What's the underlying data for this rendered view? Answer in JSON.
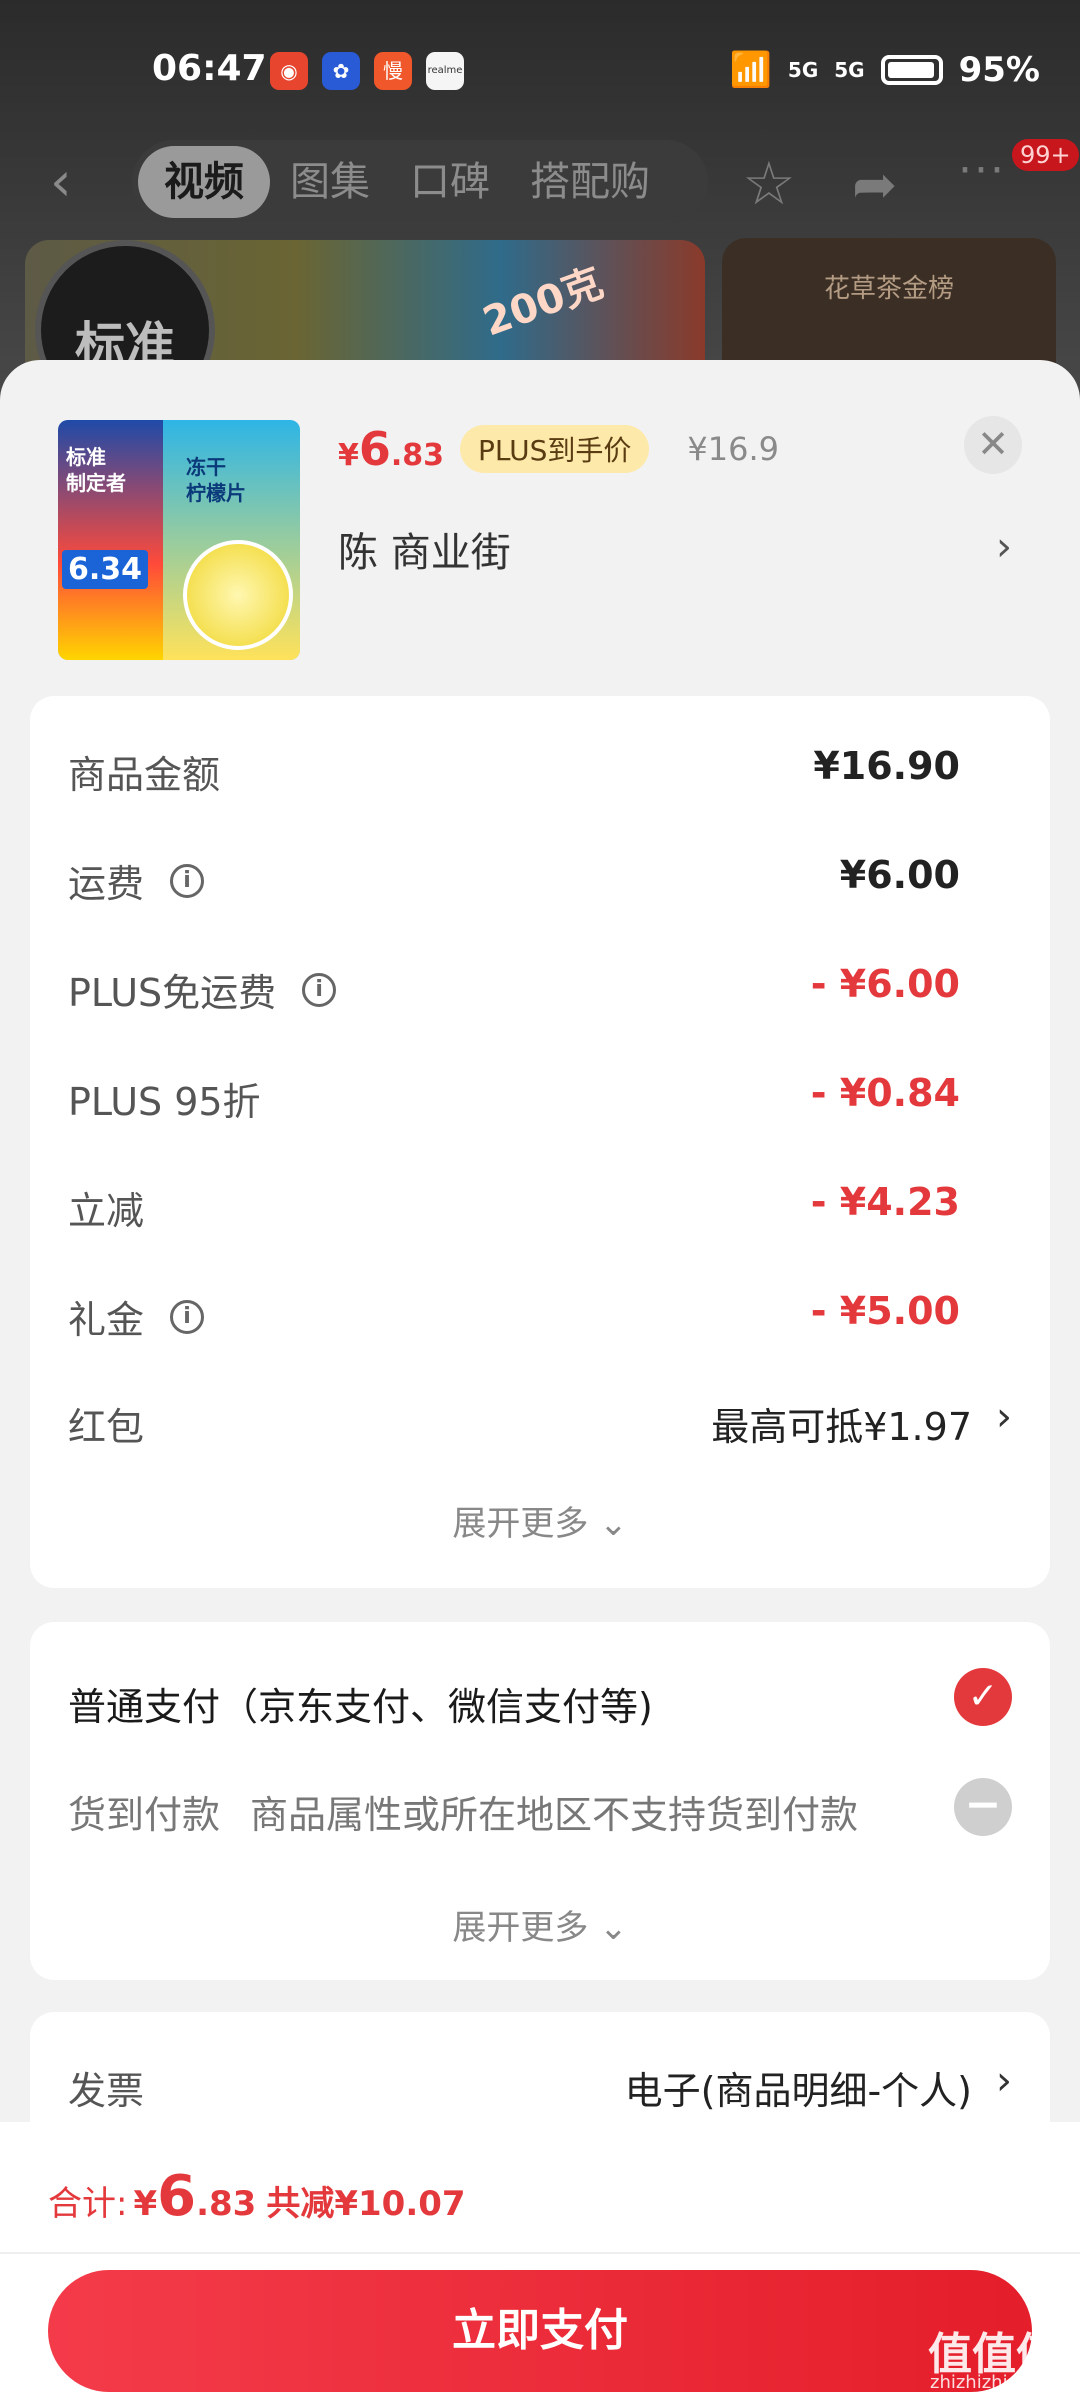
{
  "status_bar": {
    "time": "06:47",
    "apps": [
      "app-icon-1",
      "baidu-icon",
      "慢",
      "realme"
    ],
    "signal_1": "5G",
    "signal_2": "5G",
    "battery": "95%"
  },
  "top_nav": {
    "tabs": [
      "视频",
      "图集",
      "口碑",
      "搭配购"
    ],
    "active_tab": "视频",
    "badge": "99+"
  },
  "background": {
    "banner_seal": "标准",
    "banner_stamp": "200克",
    "banner2_title": "花草茶金榜"
  },
  "product": {
    "price_symbol": "¥",
    "price_int": "6",
    "price_dec": ".83",
    "plus_tag": "PLUS到手价",
    "original_price": "¥16.9",
    "store": "陈 商业街",
    "image_text_left": "标准\n制定者",
    "image_price": "6.34",
    "image_text_right": "冻干\n柠檬片"
  },
  "summary": {
    "rows": [
      {
        "label": "商品金额",
        "value": "¥16.90"
      },
      {
        "label": "运费",
        "value": "¥6.00"
      },
      {
        "label": "PLUS免运费",
        "value": "- ¥6.00"
      },
      {
        "label": "PLUS 95折",
        "value": "- ¥0.84"
      },
      {
        "label": "立减",
        "value": "- ¥4.23"
      },
      {
        "label": "礼金",
        "value": "- ¥5.00"
      },
      {
        "label": "红包",
        "value": "最高可抵¥1.97"
      }
    ],
    "expand_more": "展开更多 ⌄"
  },
  "payment": {
    "normal": "普通支付（京东支付、微信支付等)",
    "cod_label": "货到付款",
    "cod_note": "商品属性或所在地区不支持货到付款",
    "expand_more": "展开更多 ⌄"
  },
  "invoice": {
    "label": "发票",
    "value": "电子(商品明细-个人)"
  },
  "footer": {
    "total_label": "合计:",
    "total_symbol": "¥",
    "total_int": "6",
    "total_dec": ".83",
    "discount": "共减¥10.07",
    "pay_button": "立即支付"
  },
  "watermark": {
    "main": "值值值",
    "sub": "zhizhizhi.com"
  },
  "colors": {
    "accent_red": "#e4393c",
    "plus_gold": "#fde9a9",
    "sheet_bg": "#f2f2f2"
  }
}
